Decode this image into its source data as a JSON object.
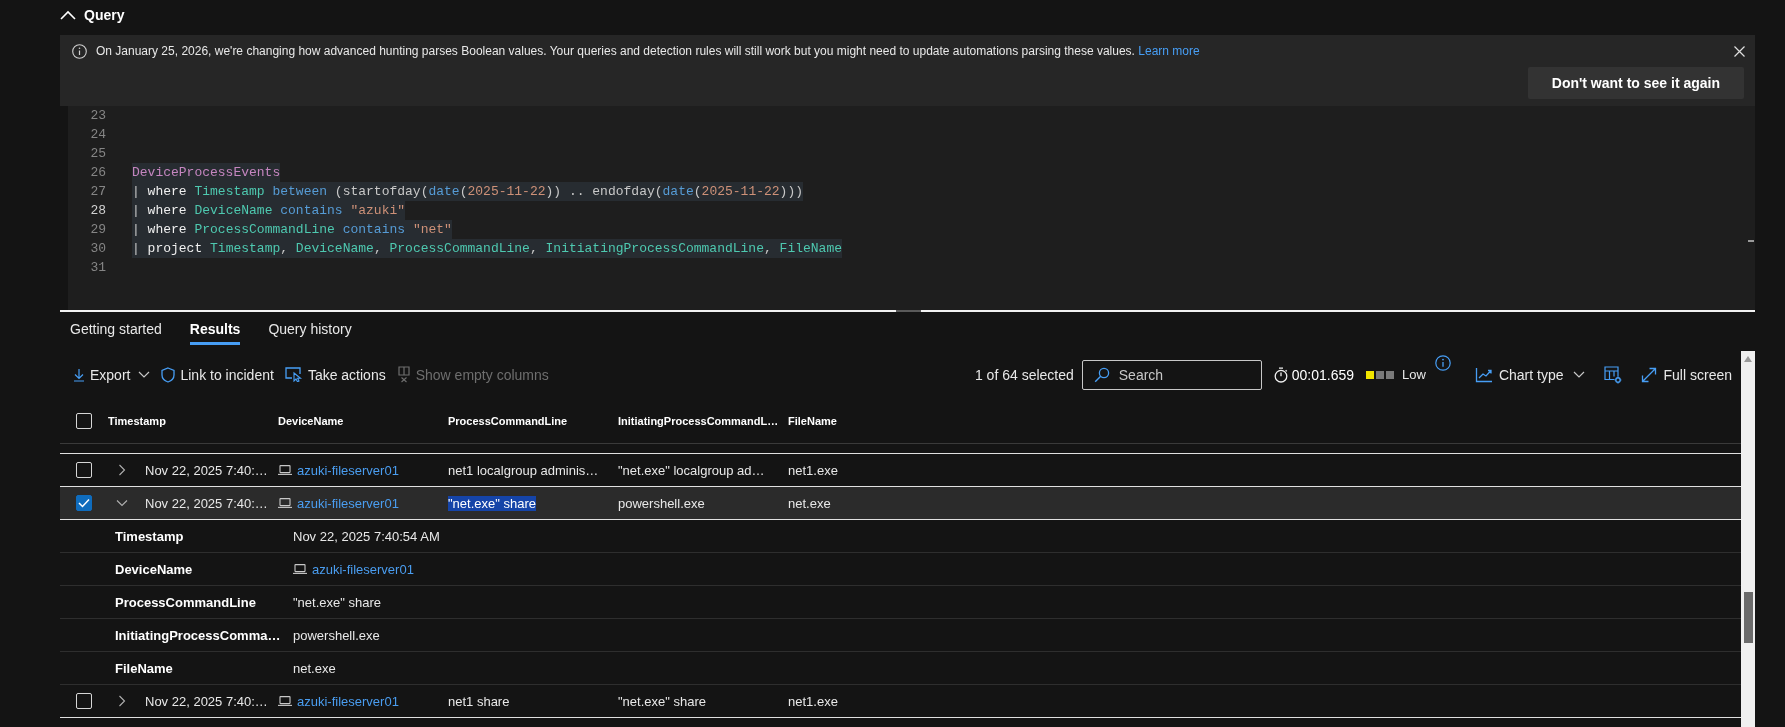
{
  "query_panel": {
    "title": "Query",
    "expanded": true
  },
  "banner": {
    "message": "On January 25, 2026, we're changing how advanced hunting parses Boolean values. Your queries and detection rules will still work but you might need to update automations parsing these values.",
    "link": "Learn more",
    "button": "Don't want to see it again"
  },
  "editor": {
    "lines": [
      {
        "number": "23",
        "current": false,
        "highlighted": false
      },
      {
        "number": "24",
        "current": false,
        "highlighted": false
      },
      {
        "number": "25",
        "current": false,
        "highlighted": false
      },
      {
        "number": "26",
        "current": false,
        "highlighted": true,
        "tokens": [
          {
            "text": "DeviceProcessEvents",
            "kind": "table"
          }
        ]
      },
      {
        "number": "27",
        "current": false,
        "highlighted": true,
        "tokens": [
          {
            "text": "| ",
            "kind": "plain"
          },
          {
            "text": "where ",
            "kind": "keyword"
          },
          {
            "text": "Timestamp ",
            "kind": "column"
          },
          {
            "text": "between",
            "kind": "operator"
          },
          {
            "text": " (startofday(",
            "kind": "plain"
          },
          {
            "text": "date",
            "kind": "operator"
          },
          {
            "text": "(",
            "kind": "plain"
          },
          {
            "text": "2025-11-22",
            "kind": "literal"
          },
          {
            "text": ")) .. endofday(",
            "kind": "plain"
          },
          {
            "text": "date",
            "kind": "operator"
          },
          {
            "text": "(",
            "kind": "plain"
          },
          {
            "text": "2025-11-22",
            "kind": "literal"
          },
          {
            "text": ")))",
            "kind": "plain"
          }
        ]
      },
      {
        "number": "28",
        "current": true,
        "highlighted": true,
        "tokens": [
          {
            "text": "| ",
            "kind": "plain"
          },
          {
            "text": "where ",
            "kind": "keyword"
          },
          {
            "text": "DeviceName ",
            "kind": "column"
          },
          {
            "text": "contains ",
            "kind": "operator"
          },
          {
            "text": "\"azuki\"",
            "kind": "literal"
          }
        ]
      },
      {
        "number": "29",
        "current": false,
        "highlighted": true,
        "tokens": [
          {
            "text": "| ",
            "kind": "plain"
          },
          {
            "text": "where ",
            "kind": "keyword"
          },
          {
            "text": "ProcessCommandLine ",
            "kind": "column"
          },
          {
            "text": "contains ",
            "kind": "operator"
          },
          {
            "text": "\"net\"",
            "kind": "literal"
          }
        ]
      },
      {
        "number": "30",
        "current": false,
        "highlighted": true,
        "tokens": [
          {
            "text": "| ",
            "kind": "plain"
          },
          {
            "text": "project ",
            "kind": "keyword"
          },
          {
            "text": "Timestamp",
            "kind": "column"
          },
          {
            "text": ", ",
            "kind": "plain"
          },
          {
            "text": "DeviceName",
            "kind": "column"
          },
          {
            "text": ", ",
            "kind": "plain"
          },
          {
            "text": "ProcessCommandLine",
            "kind": "column"
          },
          {
            "text": ", ",
            "kind": "plain"
          },
          {
            "text": "InitiatingProcessCommandLine",
            "kind": "column"
          },
          {
            "text": ", ",
            "kind": "plain"
          },
          {
            "text": "FileName",
            "kind": "column"
          }
        ]
      },
      {
        "number": "31",
        "current": false,
        "highlighted": false
      }
    ]
  },
  "results": {
    "tabs": [
      {
        "label": "Getting started",
        "selected": false
      },
      {
        "label": "Results",
        "selected": true
      },
      {
        "label": "Query history",
        "selected": false
      }
    ],
    "toolbar": {
      "actions": [
        {
          "label": "Export",
          "kind": "export",
          "disabled": false
        },
        {
          "label": "Link to incident",
          "kind": "link",
          "disabled": false
        },
        {
          "label": "Take actions",
          "kind": "actions",
          "disabled": false
        },
        {
          "label": "Show empty columns",
          "kind": "columns",
          "disabled": true
        }
      ],
      "selection_count": "1 of 64 selected",
      "search": {
        "placeholder": "Search"
      },
      "duration": "00:01.659",
      "resource_usage": {
        "level": 0.33,
        "label": "Low"
      },
      "chart_type": {
        "label": "Chart type"
      },
      "full_screen": {
        "label": "Full screen"
      }
    },
    "table": {
      "select_all": {
        "checked": false
      },
      "columns": [
        {
          "label": "Timestamp",
          "kind": "text"
        },
        {
          "label": "DeviceName",
          "kind": "device"
        },
        {
          "label": "ProcessCommandLine",
          "kind": "text"
        },
        {
          "label": "InitiatingProcessCommandL…",
          "kind": "text"
        },
        {
          "label": "FileName",
          "kind": "text"
        }
      ],
      "rows": [
        {
          "selected": false,
          "expanded": false,
          "cells": [
            {
              "text": "Nov 22, 2025 7:40:…",
              "highlighted": false
            },
            {
              "text": "azuki-fileserver01",
              "highlighted": false
            },
            {
              "text": "net1 localgroup adminis…",
              "highlighted": false
            },
            {
              "text": "\"net.exe\" localgroup ad…",
              "highlighted": false
            },
            {
              "text": "net1.exe",
              "highlighted": false
            }
          ]
        },
        {
          "selected": true,
          "expanded": true,
          "cells": [
            {
              "text": "Nov 22, 2025 7:40:…",
              "highlighted": false
            },
            {
              "text": "azuki-fileserver01",
              "highlighted": false
            },
            {
              "text": "\"net.exe\" share",
              "highlighted": true
            },
            {
              "text": "powershell.exe",
              "highlighted": false
            },
            {
              "text": "net.exe",
              "highlighted": false
            }
          ],
          "details": [
            {
              "label": "Timestamp",
              "value": "Nov 22, 2025 7:40:54 AM",
              "kind": "text"
            },
            {
              "label": "DeviceName",
              "value": "azuki-fileserver01",
              "kind": "device"
            },
            {
              "label": "ProcessCommandLine",
              "value": "\"net.exe\" share",
              "kind": "text"
            },
            {
              "label": "InitiatingProcessComma…",
              "value": "powershell.exe",
              "kind": "text"
            },
            {
              "label": "FileName",
              "value": "net.exe",
              "kind": "text"
            }
          ]
        },
        {
          "selected": false,
          "expanded": false,
          "cells": [
            {
              "text": "Nov 22, 2025 7:40:…",
              "highlighted": false
            },
            {
              "text": "azuki-fileserver01",
              "highlighted": false
            },
            {
              "text": "net1 share",
              "highlighted": false
            },
            {
              "text": "\"net.exe\" share",
              "highlighted": false
            },
            {
              "text": "net1.exe",
              "highlighted": false
            }
          ]
        }
      ]
    }
  }
}
